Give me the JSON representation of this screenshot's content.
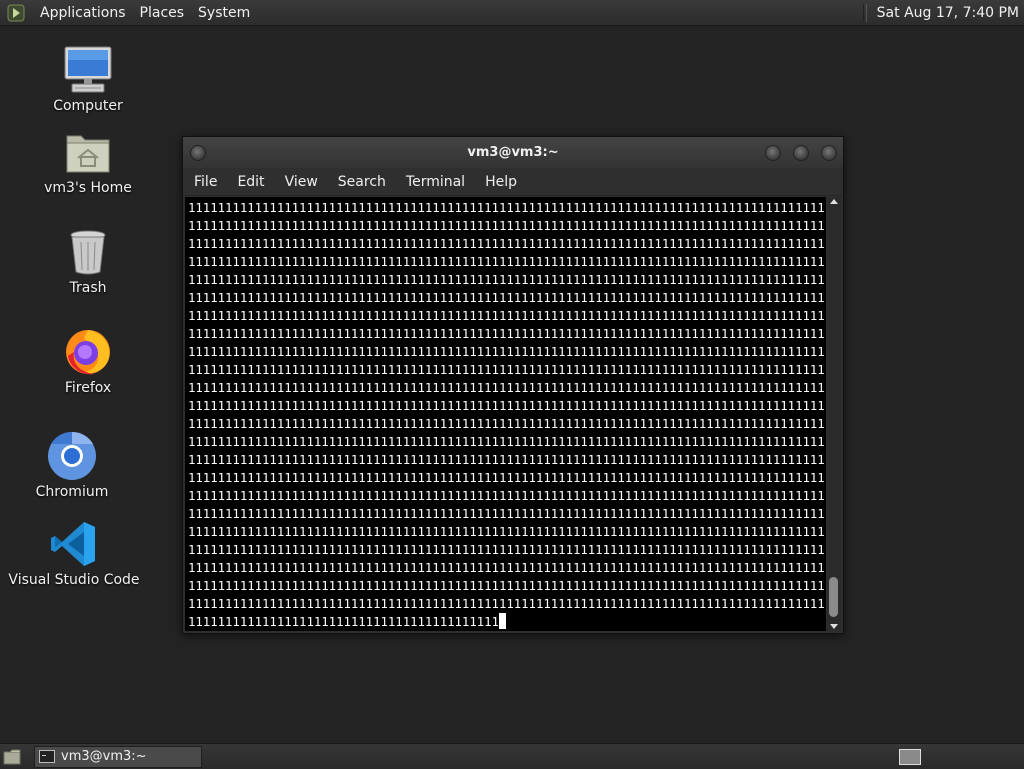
{
  "top_panel": {
    "menus": [
      "Applications",
      "Places",
      "System"
    ],
    "clock": "Sat Aug 17,  7:40 PM"
  },
  "desktop_icons": [
    {
      "label": "Computer",
      "icon": "computer-icon"
    },
    {
      "label": "vm3's Home",
      "icon": "home-folder-icon"
    },
    {
      "label": "Trash",
      "icon": "trash-icon"
    },
    {
      "label": "Firefox",
      "icon": "firefox-icon"
    },
    {
      "label": "Chromium",
      "icon": "chromium-icon"
    },
    {
      "label": "Visual Studio Code",
      "icon": "vscode-icon"
    }
  ],
  "terminal": {
    "title": "vm3@vm3:~",
    "menus": [
      "File",
      "Edit",
      "View",
      "Search",
      "Terminal",
      "Help"
    ],
    "line_char": "1",
    "full_lines": 23,
    "chars_per_line": 90,
    "last_line_chars": 42
  },
  "taskbar": {
    "window_label": "vm3@vm3:~"
  },
  "colors": {
    "desktop_bg": "#242424",
    "terminal_bg": "#000000",
    "terminal_fg": "#ffffff",
    "panel_bg": "#2e2e2e"
  }
}
